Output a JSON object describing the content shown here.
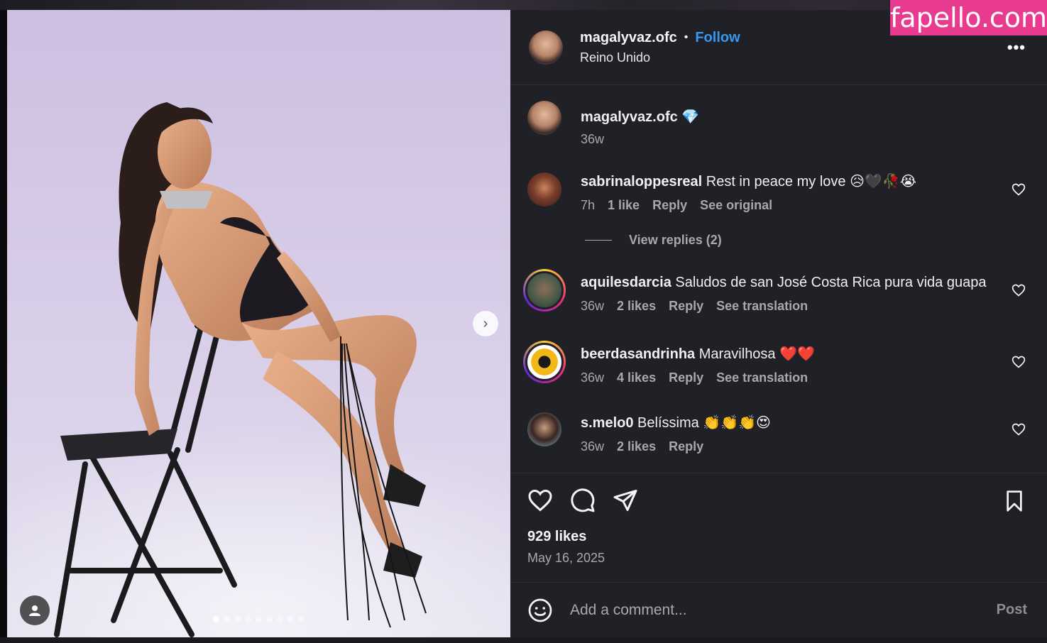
{
  "watermark": "fapello.com",
  "post": {
    "username": "magalyvaz.ofc",
    "separator": "•",
    "follow_label": "Follow",
    "location": "Reino Unido",
    "more_label": "•••"
  },
  "caption": {
    "username": "magalyvaz.ofc",
    "emoji": "💎",
    "age": "36w"
  },
  "comments": [
    {
      "user": "sabrinaloppesreal",
      "text": "Rest in peace my love 😥🖤🥀😭",
      "age": "7h",
      "likes": "1 like",
      "reply": "Reply",
      "extra": "See original"
    },
    {
      "user": "aquilesdarcia",
      "text": "Saludos de san José Costa Rica pura vida guapa",
      "age": "36w",
      "likes": "2 likes",
      "reply": "Reply",
      "extra": "See translation"
    },
    {
      "user": "beerdasandrinha",
      "text": "Maravilhosa ❤️❤️",
      "age": "36w",
      "likes": "4 likes",
      "reply": "Reply",
      "extra": "See translation"
    },
    {
      "user": "s.melo0",
      "text": "Belíssima 👏👏👏😍",
      "age": "36w",
      "likes": "2 likes",
      "reply": "Reply"
    }
  ],
  "view_replies": "View replies (2)",
  "likes_count": "929 likes",
  "post_date": "May 16, 2025",
  "add_comment": {
    "placeholder": "Add a comment...",
    "post_label": "Post"
  },
  "carousel": {
    "total_slides": 9,
    "active_slide": 1
  },
  "colors": {
    "panel_bg": "#202126",
    "follow": "#3897f0",
    "watermark_bg": "#e83a8e",
    "muted_text": "#a8a8ad"
  }
}
